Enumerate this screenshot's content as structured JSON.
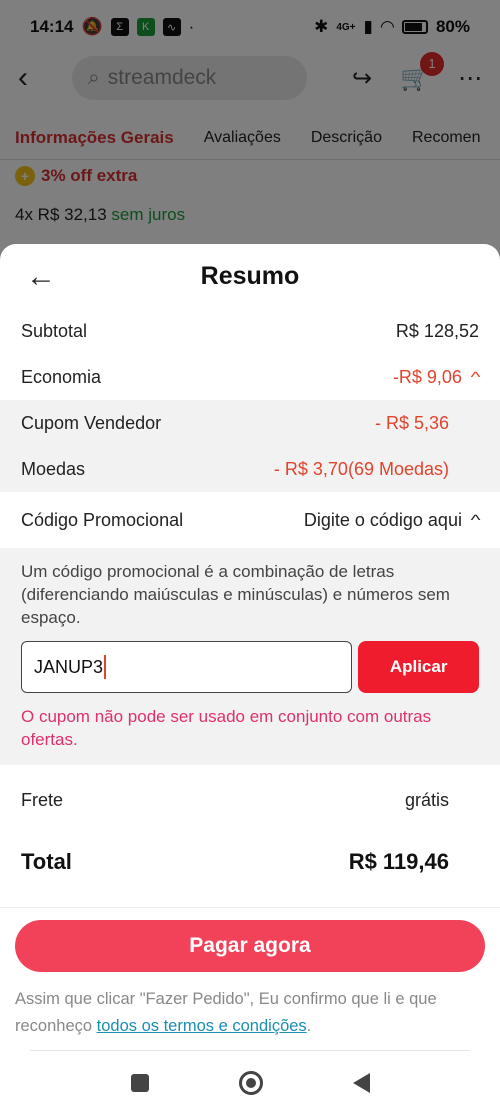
{
  "status_bar": {
    "time": "14:14",
    "network": "4G+",
    "battery": "80%",
    "app_icons": [
      "sigma-icon",
      "pix-icon",
      "voice-icon"
    ]
  },
  "top_bar": {
    "search_text": "streamdeck",
    "cart_count": "1"
  },
  "tabs": [
    {
      "label": "Informações Gerais",
      "active": true
    },
    {
      "label": "Avaliações",
      "active": false
    },
    {
      "label": "Descrição",
      "active": false
    },
    {
      "label": "Recomen",
      "active": false
    }
  ],
  "product": {
    "extra_discount": "3% off extra",
    "installments": "4x R$ 32,13",
    "installments_note": "sem juros"
  },
  "sheet": {
    "title": "Resumo",
    "subtotal_label": "Subtotal",
    "subtotal_value": "R$ 128,52",
    "savings_label": "Economia",
    "savings_value": "-R$ 9,06",
    "coupon_label": "Cupom Vendedor",
    "coupon_value": "- R$ 5,36",
    "coins_label": "Moedas",
    "coins_value": "- R$ 3,70(69 Moedas)",
    "promo_label": "Código Promocional",
    "promo_action": "Digite o código aqui",
    "promo_desc": "Um código promocional é a combinação de letras (diferenciando maiúsculas e minúsculas) e números sem espaço.",
    "promo_input_value": "JANUP3",
    "apply_label": "Aplicar",
    "promo_error": "O cupom não pode ser usado em conjunto com outras ofertas.",
    "shipping_label": "Frete",
    "shipping_value": "grátis",
    "total_label": "Total",
    "total_value": "R$ 119,46",
    "pay_label": "Pagar agora",
    "terms_text": "Assim que clicar \"Fazer Pedido\", Eu confirmo que li e que reconheço ",
    "terms_link": "todos os termos e condições",
    "terms_end": "."
  },
  "colors": {
    "accent_red": "#e0442c",
    "pay_button": "#f2425a",
    "apply_button": "#ef1c2d",
    "link": "#1b8fb0"
  }
}
